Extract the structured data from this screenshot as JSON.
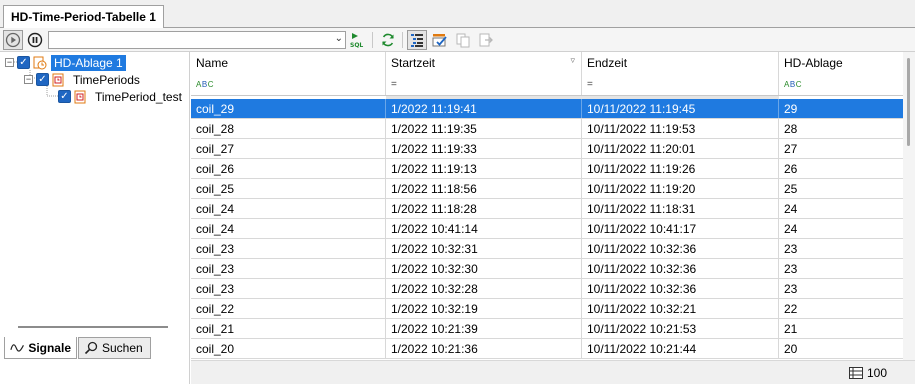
{
  "tabs": [
    {
      "label": "HD-Time-Period-Tabelle 1"
    }
  ],
  "toolbar": {
    "combo_value": "",
    "icons": [
      "play-icon",
      "pause-icon",
      "sql-run-icon",
      "refresh-icon",
      "tree-view-icon",
      "checked-list-icon",
      "copy-icon",
      "export-icon"
    ]
  },
  "tree": {
    "items": [
      {
        "label": "HD-Ablage 1",
        "selected": true
      },
      {
        "label": "TimePeriods"
      },
      {
        "label": "TimePeriod_test"
      }
    ]
  },
  "bottom_tabs": [
    {
      "label": "Signale",
      "icon": "wave-icon"
    },
    {
      "label": "Suchen",
      "icon": "search-icon"
    }
  ],
  "table": {
    "columns": [
      "Name",
      "Startzeit",
      "Endzeit",
      "HD-Ablage"
    ],
    "filters": [
      "ABC",
      "=",
      "=",
      "ABC"
    ],
    "rows": [
      [
        "coil_29",
        "1/2022 11:19:41",
        "10/11/2022 11:19:45",
        "29"
      ],
      [
        "coil_28",
        "1/2022 11:19:35",
        "10/11/2022 11:19:53",
        "28"
      ],
      [
        "coil_27",
        "1/2022 11:19:33",
        "10/11/2022 11:20:01",
        "27"
      ],
      [
        "coil_26",
        "1/2022 11:19:13",
        "10/11/2022 11:19:26",
        "26"
      ],
      [
        "coil_25",
        "1/2022 11:18:56",
        "10/11/2022 11:19:20",
        "25"
      ],
      [
        "coil_24",
        "1/2022 11:18:28",
        "10/11/2022 11:18:31",
        "24"
      ],
      [
        "coil_24",
        "1/2022 10:41:14",
        "10/11/2022 10:41:17",
        "24"
      ],
      [
        "coil_23",
        "1/2022 10:32:31",
        "10/11/2022 10:32:36",
        "23"
      ],
      [
        "coil_23",
        "1/2022 10:32:30",
        "10/11/2022 10:32:36",
        "23"
      ],
      [
        "coil_23",
        "1/2022 10:32:28",
        "10/11/2022 10:32:36",
        "23"
      ],
      [
        "coil_22",
        "1/2022 10:32:19",
        "10/11/2022 10:32:21",
        "22"
      ],
      [
        "coil_21",
        "1/2022 10:21:39",
        "10/11/2022 10:21:53",
        "21"
      ],
      [
        "coil_20",
        "1/2022 10:21:36",
        "10/11/2022 10:21:44",
        "20"
      ]
    ],
    "selected_row": 0
  },
  "status": {
    "row_count": "100"
  },
  "colors": {
    "selection": "#1f7ae0",
    "checkbox": "#1f66c2"
  }
}
